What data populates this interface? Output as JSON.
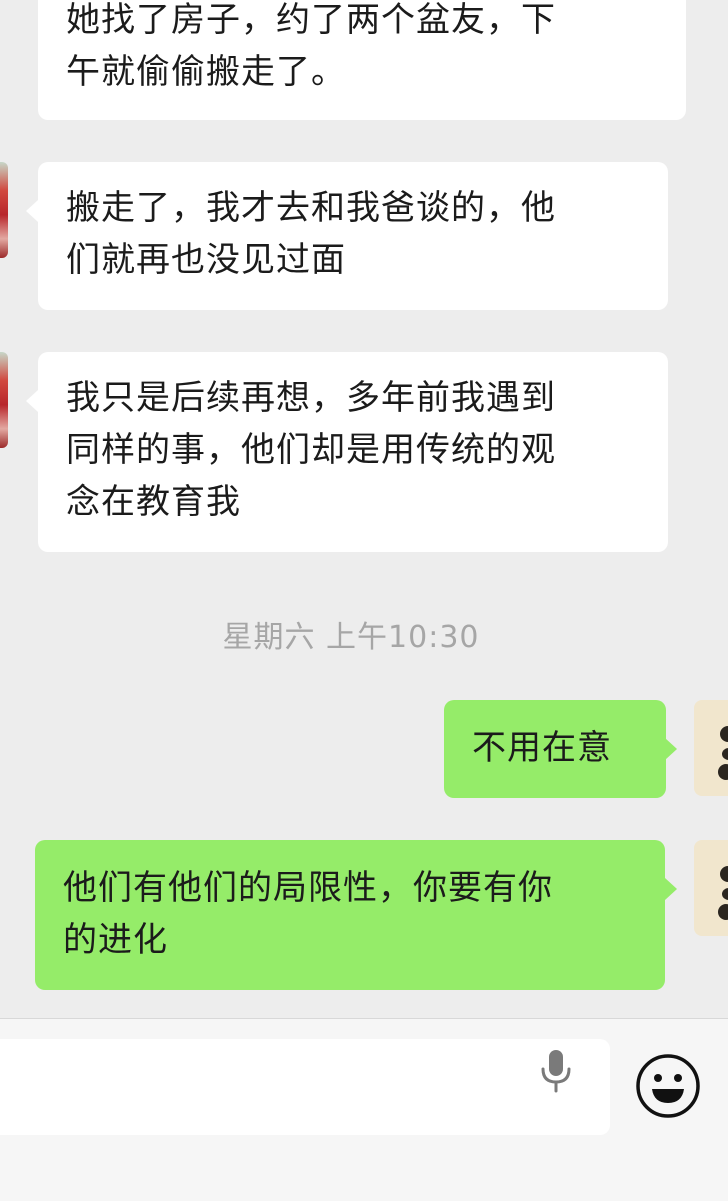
{
  "chat": {
    "messages": [
      {
        "side": "in",
        "text": "她找了房子，约了两个盆友，下\n午就偷偷搬走了。"
      },
      {
        "side": "in",
        "text": "搬走了，我才去和我爸谈的，他\n们就再也没见过面"
      },
      {
        "side": "in",
        "text": "我只是后续再想，多年前我遇到\n同样的事，他们却是用传统的观\n念在教育我"
      },
      {
        "side": "out",
        "text": "不用在意"
      },
      {
        "side": "out",
        "text": "他们有他们的局限性，你要有你\n的进化"
      }
    ],
    "timestamp": "星期六 上午10:30"
  },
  "input": {
    "value": "",
    "mic_icon": "microphone-icon",
    "emoji_icon": "emoji-smile-icon"
  },
  "colors": {
    "background": "#ededed",
    "incoming_bubble": "#ffffff",
    "outgoing_bubble": "#95ec69",
    "timestamp_text": "#a6a6a6"
  }
}
